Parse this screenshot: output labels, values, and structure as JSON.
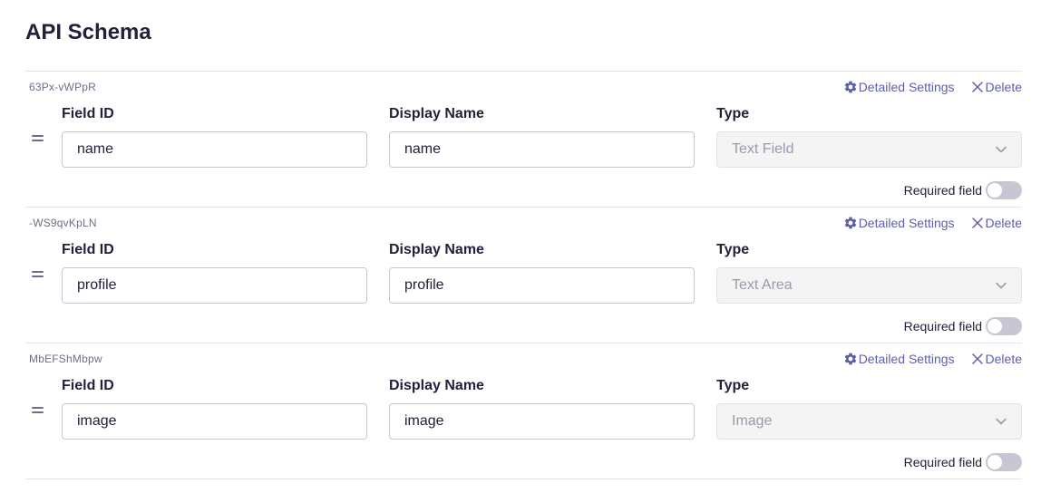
{
  "page": {
    "title": "API Schema"
  },
  "labels": {
    "detailed_settings": "Detailed Settings",
    "delete": "Delete",
    "field_id": "Field ID",
    "display_name": "Display Name",
    "type": "Type",
    "required_field": "Required field"
  },
  "fields": [
    {
      "key": "63Px-vWPpR",
      "field_id": "name",
      "display_name": "name",
      "type": "Text Field",
      "required": false
    },
    {
      "key": "-WS9qvKpLN",
      "field_id": "profile",
      "display_name": "profile",
      "type": "Text Area",
      "required": false
    },
    {
      "key": "MbEFShMbpw",
      "field_id": "image",
      "display_name": "image",
      "type": "Image",
      "required": false
    }
  ],
  "colors": {
    "accent": "#5e5ea8",
    "text": "#21213b",
    "muted": "#6e6e8c",
    "border": "#c7c7d3",
    "disabled_bg": "#f4f4f4",
    "toggle_off": "#c7c7d3"
  },
  "icons": {
    "settings": "gear-icon",
    "delete": "close-icon",
    "drag": "drag-handle-icon",
    "select": "chevron-down-icon"
  }
}
